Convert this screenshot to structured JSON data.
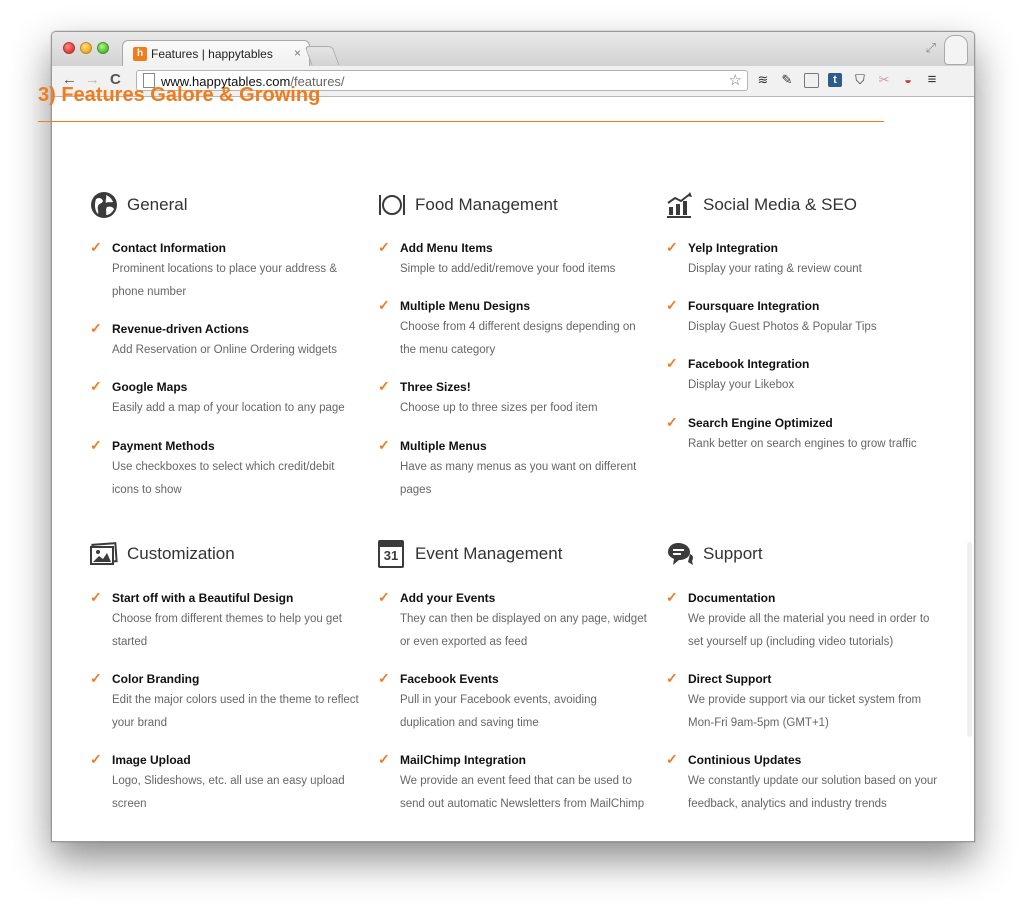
{
  "browser": {
    "tab_title": "Features | happytables",
    "tab_close": "×",
    "url_host": "www.happytables.com",
    "url_path": "/features/",
    "back": "←",
    "forward": "→",
    "reload": "C",
    "favicon_letter": "h"
  },
  "page": {
    "section_title": "3) Features Galore & Growing",
    "accent_color": "#f07c1c",
    "categories": [
      {
        "title": "General",
        "icon": "globe-icon",
        "features": [
          {
            "title": "Contact Information",
            "desc": "Prominent locations to place your address & phone number"
          },
          {
            "title": "Revenue-driven Actions",
            "desc": "Add Reservation or Online Ordering widgets"
          },
          {
            "title": "Google Maps",
            "desc": "Easily add a map of your location to any page"
          },
          {
            "title": "Payment Methods",
            "desc": "Use checkboxes to select which credit/debit icons to show"
          }
        ]
      },
      {
        "title": "Food Management",
        "icon": "plate-icon",
        "features": [
          {
            "title": "Add Menu Items",
            "desc": "Simple to add/edit/remove your food items"
          },
          {
            "title": "Multiple Menu Designs",
            "desc": "Choose from 4 different designs depending on the menu category"
          },
          {
            "title": "Three Sizes!",
            "desc": "Choose up to three sizes per food item"
          },
          {
            "title": "Multiple Menus",
            "desc": "Have as many menus as you want on different pages"
          }
        ]
      },
      {
        "title": "Social Media & SEO",
        "icon": "chart-icon",
        "features": [
          {
            "title": "Yelp Integration",
            "desc": "Display your rating & review count"
          },
          {
            "title": "Foursquare Integration",
            "desc": "Display Guest Photos & Popular Tips"
          },
          {
            "title": "Facebook Integration",
            "desc": "Display your Likebox"
          },
          {
            "title": "Search Engine Optimized",
            "desc": "Rank better on search engines to grow traffic"
          }
        ]
      },
      {
        "title": "Customization",
        "icon": "picture-icon",
        "features": [
          {
            "title": "Start off with a Beautiful Design",
            "desc": "Choose from different themes to help you get started"
          },
          {
            "title": "Color Branding",
            "desc": "Edit the major colors used in the theme to reflect your brand"
          },
          {
            "title": "Image Upload",
            "desc": "Logo, Slideshows, etc. all use an easy upload screen"
          }
        ]
      },
      {
        "title": "Event Management",
        "icon": "calendar-icon",
        "calendar_day": "31",
        "features": [
          {
            "title": "Add your Events",
            "desc": "They can then be displayed on any page, widget or even exported as feed"
          },
          {
            "title": "Facebook Events",
            "desc": "Pull in your Facebook events, avoiding duplication and saving time"
          },
          {
            "title": "MailChimp Integration",
            "desc": "We provide an event feed that can be used to send out automatic Newsletters from MailChimp"
          }
        ]
      },
      {
        "title": "Support",
        "icon": "speech-bubble-icon",
        "features": [
          {
            "title": "Documentation",
            "desc": "We provide all the material you need in order to set yourself up (including video tutorials)"
          },
          {
            "title": "Direct Support",
            "desc": "We provide support via our ticket system from Mon-Fri 9am-5pm (GMT+1)"
          },
          {
            "title": "Continious Updates",
            "desc": "We constantly update our solution based on your feedback, analytics and industry trends"
          }
        ]
      }
    ],
    "check_glyph": "✓"
  }
}
